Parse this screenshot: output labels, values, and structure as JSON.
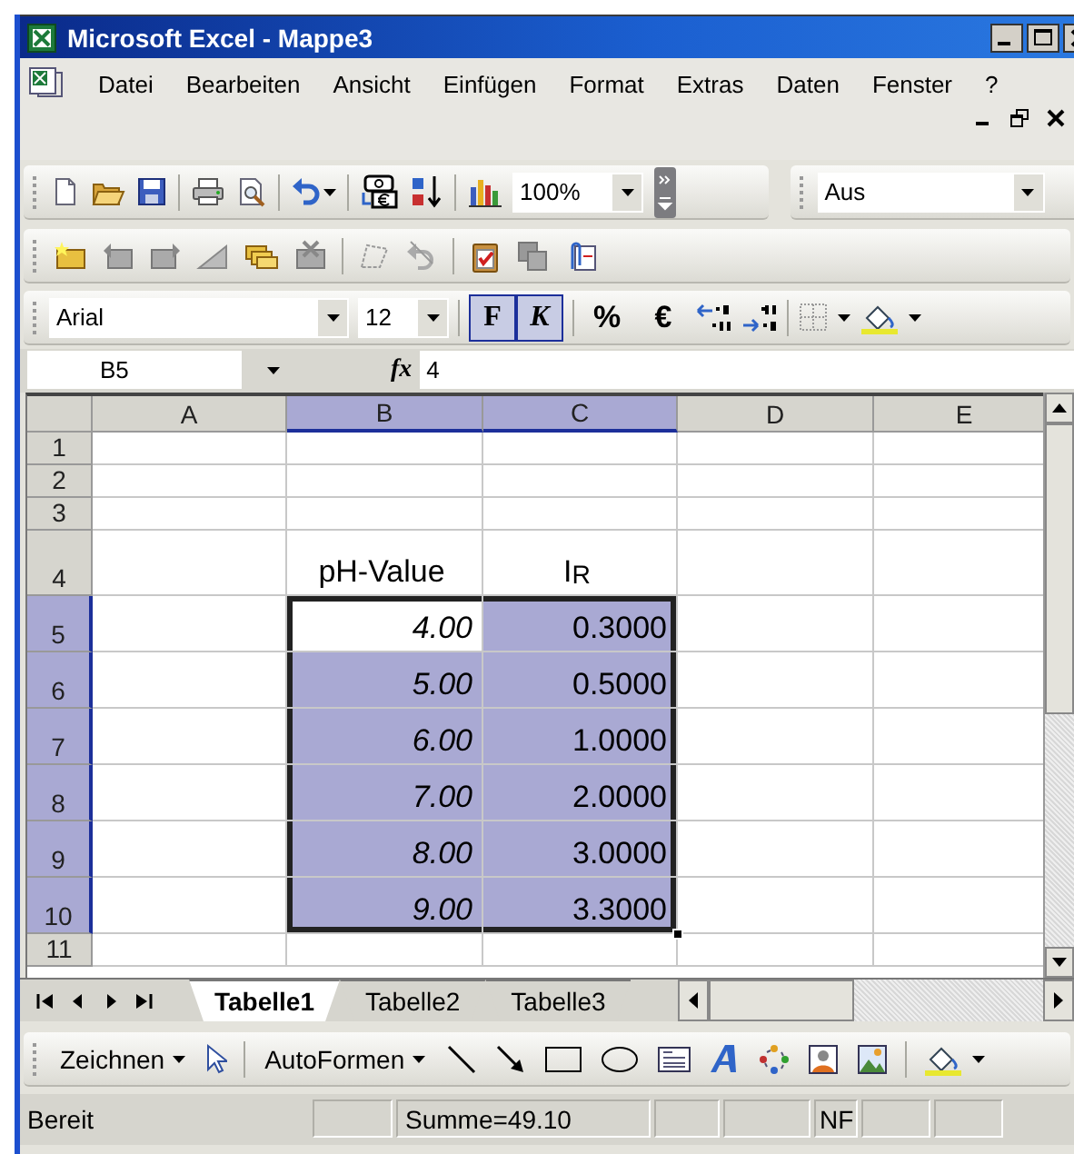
{
  "window": {
    "title": "Microsoft Excel - Mappe3"
  },
  "menu": {
    "items": [
      "Datei",
      "Bearbeiten",
      "Ansicht",
      "Einfügen",
      "Format",
      "Extras",
      "Daten",
      "Fenster",
      "?"
    ]
  },
  "standard_toolbar": {
    "zoom": "100%",
    "style_box": "Aus"
  },
  "formatting_toolbar": {
    "font": "Arial",
    "size": "12",
    "buttons": [
      {
        "label": "F",
        "kind": "bold",
        "selected": true
      },
      {
        "label": "K",
        "kind": "italic",
        "selected": true
      },
      {
        "label": "%",
        "kind": "symbol",
        "selected": false
      },
      {
        "label": "€",
        "kind": "symbol",
        "selected": false
      }
    ]
  },
  "formula_bar": {
    "name_box": "B5",
    "function_label": "fx",
    "value": "4"
  },
  "sheet": {
    "columns": [
      {
        "label": "A",
        "selected": false
      },
      {
        "label": "B",
        "selected": true
      },
      {
        "label": "C",
        "selected": true
      },
      {
        "label": "D",
        "selected": false
      },
      {
        "label": "E",
        "selected": false
      }
    ],
    "rows": [
      {
        "header": "1",
        "selected": false,
        "cells": [
          {
            "selected": false,
            "active": false
          },
          {
            "selected": false,
            "active": false
          },
          {
            "selected": false,
            "active": false
          },
          {
            "selected": false,
            "active": false
          },
          {
            "selected": false,
            "active": false
          }
        ]
      },
      {
        "header": "2",
        "selected": false,
        "cells": [
          {
            "selected": false,
            "active": false
          },
          {
            "selected": false,
            "active": false
          },
          {
            "selected": false,
            "active": false
          },
          {
            "selected": false,
            "active": false
          },
          {
            "selected": false,
            "active": false
          }
        ]
      },
      {
        "header": "3",
        "selected": false,
        "cells": [
          {
            "selected": false,
            "active": false
          },
          {
            "selected": false,
            "active": false
          },
          {
            "selected": false,
            "active": false
          },
          {
            "selected": false,
            "active": false
          },
          {
            "selected": false,
            "active": false
          }
        ]
      },
      {
        "header": "4",
        "selected": false,
        "cells": [
          {
            "selected": false,
            "active": false
          },
          {
            "text": "pH-Value",
            "italic": false,
            "selected": false,
            "active": false
          },
          {
            "text": "I$_{R}$",
            "italic": false,
            "selected": false,
            "active": false
          },
          {
            "selected": false,
            "active": false
          },
          {
            "selected": false,
            "active": false
          }
        ]
      },
      {
        "header": "5",
        "selected": true,
        "cells": [
          {
            "selected": false,
            "active": false
          },
          {
            "text": "4.00",
            "italic": true,
            "selected": true,
            "active": true
          },
          {
            "text": "0.3000",
            "italic": false,
            "selected": true,
            "active": false
          },
          {
            "selected": false,
            "active": false
          },
          {
            "selected": false,
            "active": false
          }
        ]
      },
      {
        "header": "6",
        "selected": true,
        "cells": [
          {
            "selected": false,
            "active": false
          },
          {
            "text": "5.00",
            "italic": true,
            "selected": true,
            "active": false
          },
          {
            "text": "0.5000",
            "italic": false,
            "selected": true,
            "active": false
          },
          {
            "selected": false,
            "active": false
          },
          {
            "selected": false,
            "active": false
          }
        ]
      },
      {
        "header": "7",
        "selected": true,
        "cells": [
          {
            "selected": false,
            "active": false
          },
          {
            "text": "6.00",
            "italic": true,
            "selected": true,
            "active": false
          },
          {
            "text": "1.0000",
            "italic": false,
            "selected": true,
            "active": false
          },
          {
            "selected": false,
            "active": false
          },
          {
            "selected": false,
            "active": false
          }
        ]
      },
      {
        "header": "8",
        "selected": true,
        "cells": [
          {
            "selected": false,
            "active": false
          },
          {
            "text": "7.00",
            "italic": true,
            "selected": true,
            "active": false
          },
          {
            "text": "2.0000",
            "italic": false,
            "selected": true,
            "active": false
          },
          {
            "selected": false,
            "active": false
          },
          {
            "selected": false,
            "active": false
          }
        ]
      },
      {
        "header": "9",
        "selected": true,
        "cells": [
          {
            "selected": false,
            "active": false
          },
          {
            "text": "8.00",
            "italic": true,
            "selected": true,
            "active": false
          },
          {
            "text": "3.0000",
            "italic": false,
            "selected": true,
            "active": false
          },
          {
            "selected": false,
            "active": false
          },
          {
            "selected": false,
            "active": false
          }
        ]
      },
      {
        "header": "10",
        "selected": true,
        "cells": [
          {
            "selected": false,
            "active": false
          },
          {
            "text": "9.00",
            "italic": true,
            "selected": true,
            "active": false
          },
          {
            "text": "3.3000",
            "italic": false,
            "selected": true,
            "active": false
          },
          {
            "selected": false,
            "active": false
          },
          {
            "selected": false,
            "active": false
          }
        ]
      },
      {
        "header": "11",
        "selected": false,
        "cells": [
          {
            "selected": false,
            "active": false
          },
          {
            "selected": false,
            "active": false
          },
          {
            "selected": false,
            "active": false
          },
          {
            "selected": false,
            "active": false
          },
          {
            "selected": false,
            "active": false
          }
        ]
      }
    ]
  },
  "sheet_tabs": [
    {
      "label": "Tabelle1",
      "selected": true
    },
    {
      "label": "Tabelle2",
      "selected": false
    },
    {
      "label": "Tabelle3",
      "selected": false
    }
  ],
  "drawing_toolbar": {
    "draw_menu": "Zeichnen",
    "autoshapes_menu": "AutoFormen"
  },
  "status_bar": {
    "mode": "Bereit",
    "sum": "Summe=49.10",
    "keys": "NF"
  }
}
